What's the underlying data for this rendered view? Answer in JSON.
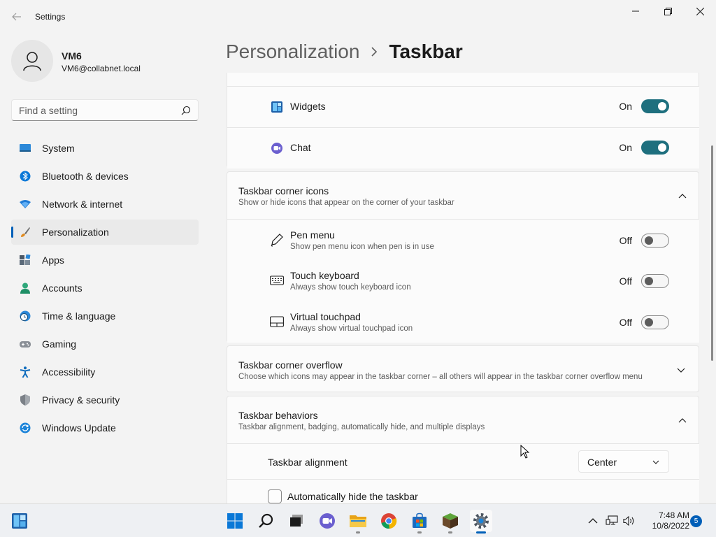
{
  "window": {
    "title": "Settings"
  },
  "user": {
    "name": "VM6",
    "email": "VM6@collabnet.local"
  },
  "search": {
    "placeholder": "Find a setting"
  },
  "sidebar": {
    "items": [
      {
        "label": "System",
        "icon": "monitor-icon"
      },
      {
        "label": "Bluetooth & devices",
        "icon": "bluetooth-icon"
      },
      {
        "label": "Network & internet",
        "icon": "wifi-icon"
      },
      {
        "label": "Personalization",
        "icon": "brush-icon",
        "active": true
      },
      {
        "label": "Apps",
        "icon": "apps-icon"
      },
      {
        "label": "Accounts",
        "icon": "person-icon"
      },
      {
        "label": "Time & language",
        "icon": "globe-clock-icon"
      },
      {
        "label": "Gaming",
        "icon": "gamepad-icon"
      },
      {
        "label": "Accessibility",
        "icon": "accessibility-icon"
      },
      {
        "label": "Privacy & security",
        "icon": "shield-icon"
      },
      {
        "label": "Windows Update",
        "icon": "update-icon"
      }
    ]
  },
  "header": {
    "parent": "Personalization",
    "current": "Taskbar"
  },
  "taskbar_items": {
    "widgets": {
      "label": "Widgets",
      "state": "On"
    },
    "chat": {
      "label": "Chat",
      "state": "On"
    }
  },
  "corner_icons": {
    "title": "Taskbar corner icons",
    "subtitle": "Show or hide icons that appear on the corner of your taskbar",
    "items": [
      {
        "label": "Pen menu",
        "sub": "Show pen menu icon when pen is in use",
        "state": "Off"
      },
      {
        "label": "Touch keyboard",
        "sub": "Always show touch keyboard icon",
        "state": "Off"
      },
      {
        "label": "Virtual touchpad",
        "sub": "Always show virtual touchpad icon",
        "state": "Off"
      }
    ]
  },
  "corner_overflow": {
    "title": "Taskbar corner overflow",
    "subtitle": "Choose which icons may appear in the taskbar corner – all others will appear in the taskbar corner overflow menu"
  },
  "behaviors": {
    "title": "Taskbar behaviors",
    "subtitle": "Taskbar alignment, badging, automatically hide, and multiple displays",
    "alignment_label": "Taskbar alignment",
    "alignment_value": "Center",
    "autohide_label": "Automatically hide the taskbar"
  },
  "system_taskbar": {
    "time": "7:48 AM",
    "date": "10/8/2022",
    "notifications": "5"
  },
  "colors": {
    "accent": "#005fb8",
    "toggle_on": "#1e6f7e"
  }
}
